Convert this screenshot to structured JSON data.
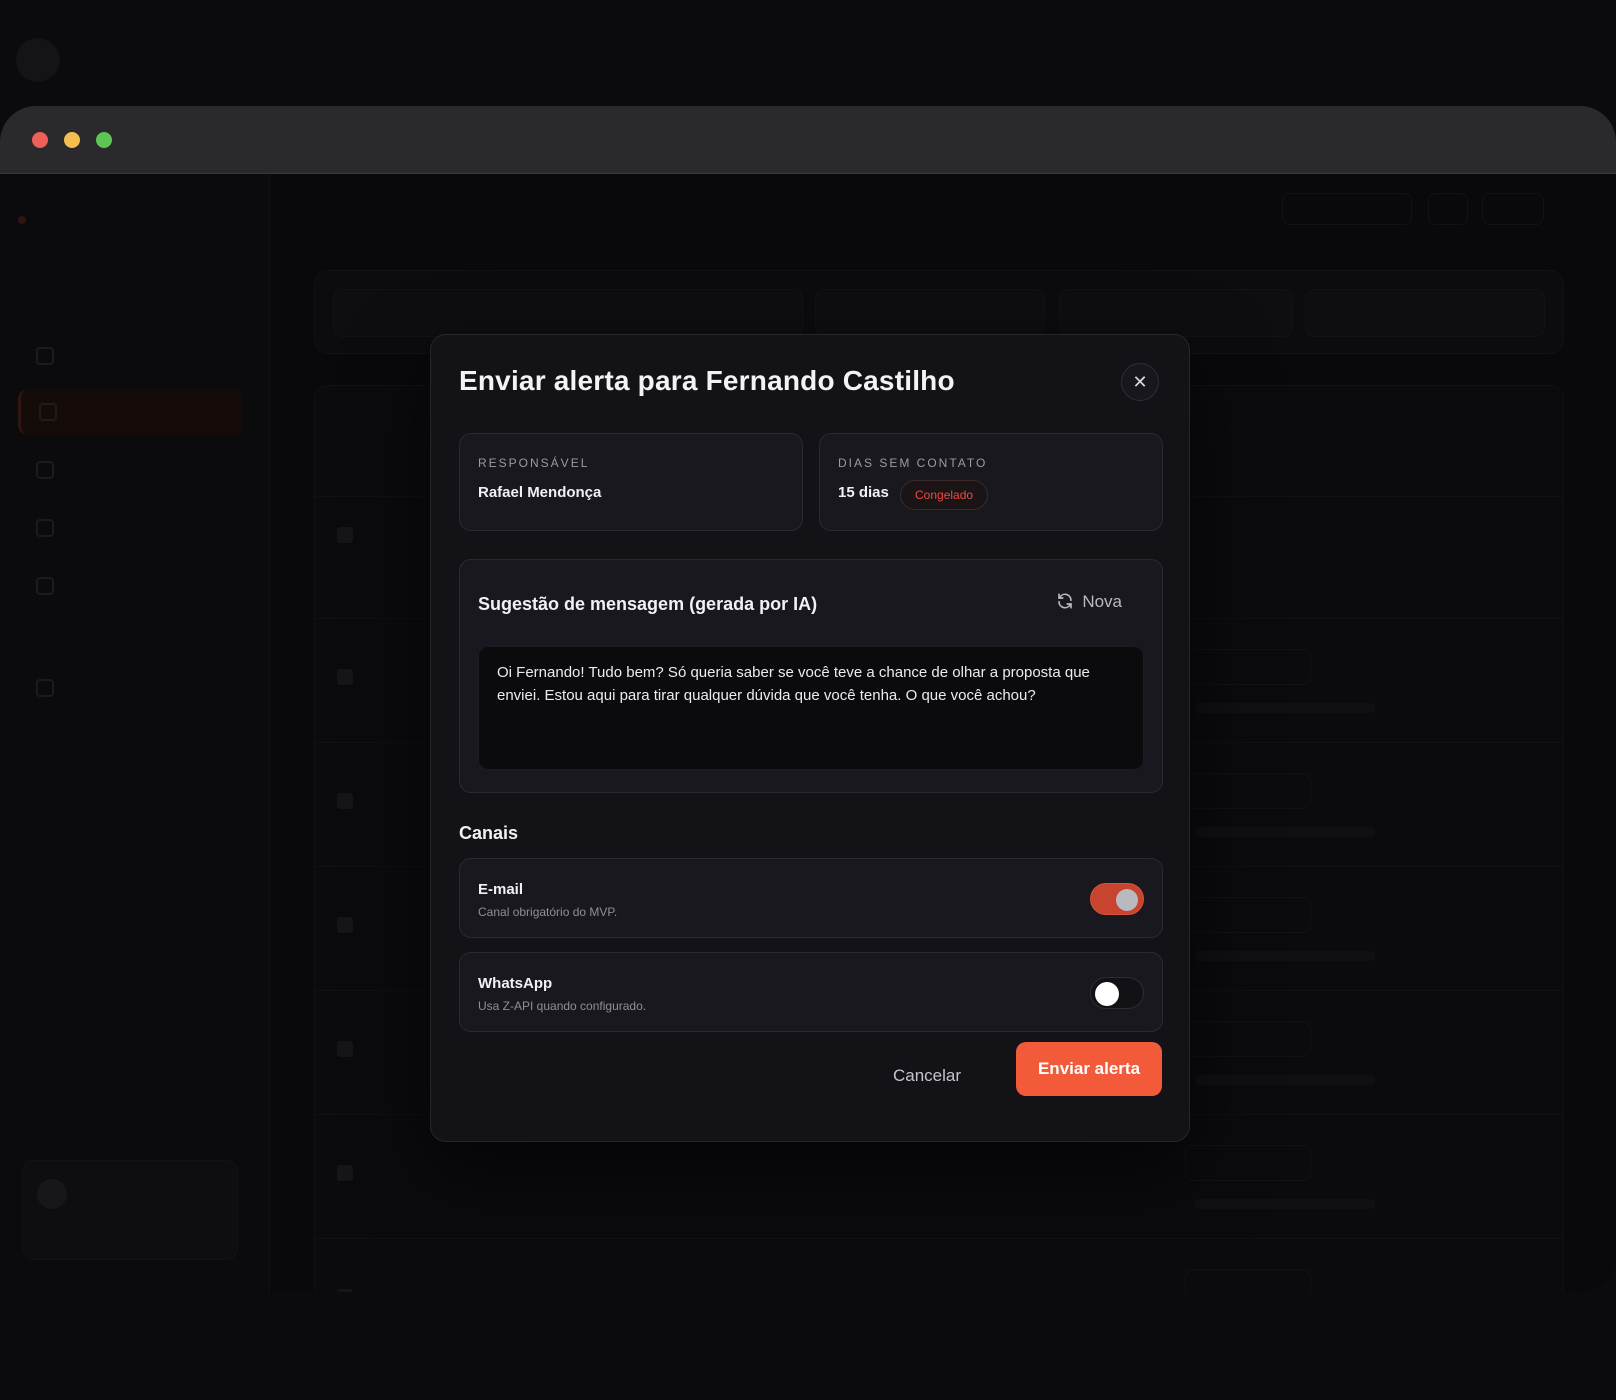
{
  "window": {
    "traffic_lights": {
      "close_color": "#ee5f57",
      "minimize_color": "#f4bd4f",
      "maximize_color": "#5ec454"
    }
  },
  "modal": {
    "title": "Enviar alerta para Fernando Castilho",
    "close_icon": "close-icon",
    "responsavel": {
      "label": "RESPONSÁVEL",
      "value": "Rafael Mendonça"
    },
    "dias_sem_contato": {
      "label": "DIAS SEM CONTATO",
      "value": "15 dias",
      "badge": "Congelado",
      "badge_color": "#f0493f"
    },
    "suggestion": {
      "title": "Sugestão de mensagem (gerada por IA)",
      "refresh_label": "Nova",
      "refresh_icon": "refresh-icon",
      "message": "Oi Fernando! Tudo bem? Só queria saber se você teve a chance de olhar a proposta que enviei. Estou aqui para tirar qualquer dúvida que você tenha. O que você achou?"
    },
    "channels": {
      "label": "Canais",
      "items": [
        {
          "name": "E-mail",
          "description": "Canal obrigatório do MVP.",
          "enabled": true
        },
        {
          "name": "WhatsApp",
          "description": "Usa Z-API quando configurado.",
          "enabled": false
        }
      ]
    },
    "actions": {
      "cancel_label": "Cancelar",
      "submit_label": "Enviar alerta"
    },
    "accent_color": "#f25a3a"
  }
}
